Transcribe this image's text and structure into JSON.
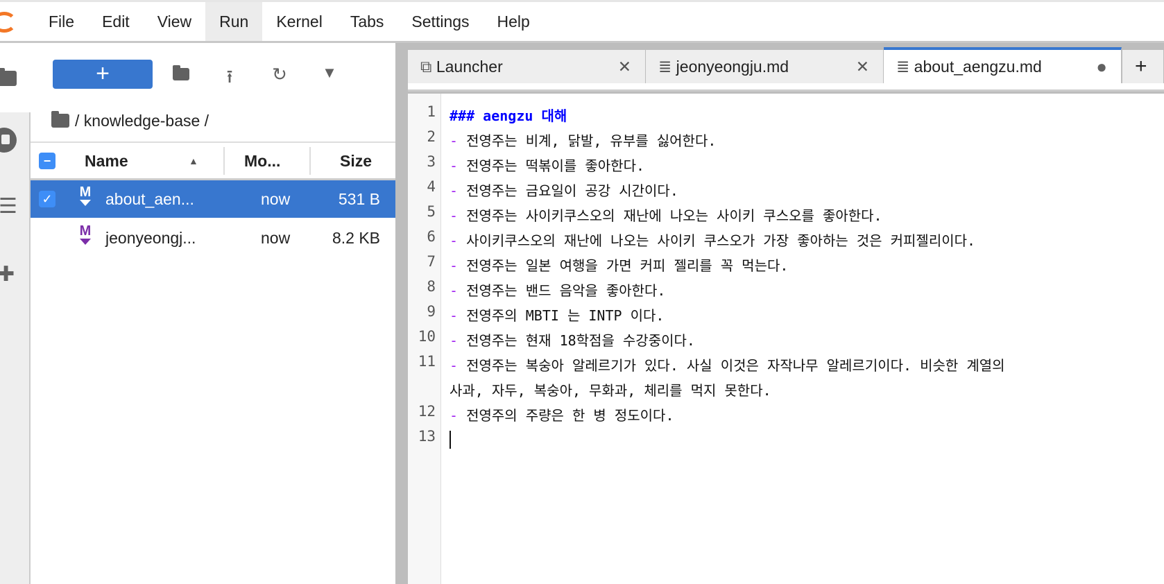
{
  "menu": [
    "File",
    "Edit",
    "View",
    "Run",
    "Kernel",
    "Tabs",
    "Settings",
    "Help"
  ],
  "browser": {
    "new_label": "+",
    "breadcrumb": "/ knowledge-base /",
    "columns": {
      "name": "Name",
      "modified": "Mo...",
      "size": "Size"
    },
    "files": [
      {
        "name": "about_aen...",
        "modified": "now",
        "size": "531 B",
        "icon": "M",
        "selected": true
      },
      {
        "name": "jeonyeongj...",
        "modified": "now",
        "size": "8.2 KB",
        "icon": "M",
        "selected": false
      }
    ]
  },
  "tabs": [
    {
      "label": "Launcher"
    },
    {
      "label": "jeonyeongju.md"
    },
    {
      "label": "about_aengzu.md"
    }
  ],
  "tab_add": "+",
  "editor": {
    "lines": [
      {
        "n": "1",
        "text": "### aengzu 대해"
      },
      {
        "n": "2",
        "text": "전영주는 비계, 닭발, 유부를 싫어한다."
      },
      {
        "n": "3",
        "text": "전영주는 떡볶이를 좋아한다."
      },
      {
        "n": "4",
        "text": "전영주는 금요일이 공강 시간이다."
      },
      {
        "n": "5",
        "text": "전영주는 사이키쿠스오의 재난에 나오는 사이키 쿠스오를 좋아한다."
      },
      {
        "n": "6",
        "text": "사이키쿠스오의 재난에 나오는 사이키 쿠스오가 가장 좋아하는 것은 커피젤리이다."
      },
      {
        "n": "7",
        "text": "전영주는 일본 여행을 가면 커피 젤리를 꼭 먹는다."
      },
      {
        "n": "8",
        "text": "전영주는 밴드 음악을 좋아한다."
      },
      {
        "n": "9",
        "text": "전영주의 MBTI 는 INTP 이다."
      },
      {
        "n": "10",
        "text": "전영주는 현재 18학점을 수강중이다."
      },
      {
        "n": "11",
        "text": "전영주는 복숭아 알레르기가 있다. 사실 이것은 자작나무 알레르기이다. 비슷한 계열의",
        "cont": "사과, 자두, 복숭아, 무화과, 체리를 먹지 못한다."
      },
      {
        "n": "12",
        "text": "전영주의 주량은 한 병 정도이다."
      },
      {
        "n": "13",
        "text": ""
      }
    ],
    "dash": "-"
  }
}
